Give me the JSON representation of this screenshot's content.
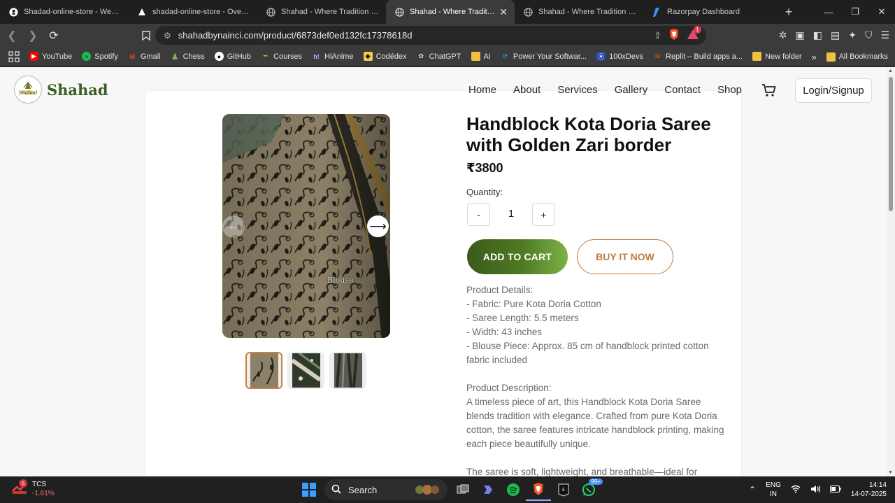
{
  "browser": {
    "tabs": [
      {
        "title": "Shadad-online-store - Web Serv",
        "favicon": "github-icon",
        "active": false
      },
      {
        "title": "shadad-online-store - Overview",
        "favicon": "vercel-icon",
        "active": false
      },
      {
        "title": "Shahad - Where Tradition Meets",
        "favicon": "globe-icon",
        "active": false
      },
      {
        "title": "Shahad - Where Tradition M",
        "favicon": "globe-icon",
        "active": true
      },
      {
        "title": "Shahad - Where Tradition Meets",
        "favicon": "globe-icon",
        "active": false
      },
      {
        "title": "Razorpay Dashboard",
        "favicon": "razorpay-icon",
        "active": false
      }
    ],
    "url": "shahadbynainci.com/product/6873def0ed132fc17378618d",
    "shield_badge": "1",
    "bookmarks": [
      "YouTube",
      "Spotify",
      "Gmail",
      "Chess",
      "GitHub",
      "Courses",
      "HiAnime",
      "Codédex",
      "ChatGPT",
      "AI",
      "Power Your Softwar...",
      "100xDevs",
      "Replit – Build apps a...",
      "New folder"
    ],
    "all_bookmarks": "All Bookmarks"
  },
  "site": {
    "brand": "Shahad",
    "logo_text": "Shahad",
    "nav": [
      "Home",
      "About",
      "Services",
      "Gallery",
      "Contact",
      "Shop"
    ],
    "login_label": "Login/Signup"
  },
  "product": {
    "title": "Handblock Kota Doria Saree with Golden Zari border",
    "price": "₹3800",
    "quantity_label": "Quantity:",
    "quantity": "1",
    "minus": "-",
    "plus": "+",
    "add_to_cart": "ADD TO CART",
    "buy_now": "BUY IT NOW",
    "image_caption": "Blouse",
    "details_heading": "Product Details:",
    "details": [
      "- Fabric: Pure Kota Doria Cotton",
      "- Saree Length: 5.5 meters",
      "- Width: 43 inches",
      "- Blouse Piece: Approx. 85 cm of handblock printed cotton fabric included"
    ],
    "description_heading": "Product Description:",
    "description": "A timeless piece of art, this Handblock Kota Doria Saree blends tradition with elegance. Crafted from pure Kota Doria cotton, the saree features intricate handblock printing, making each piece beautifully unique.",
    "description_more": "The saree is soft, lightweight, and breathable—ideal for"
  },
  "taskbar": {
    "stock_name": "TCS",
    "stock_change": "-1.61%",
    "stock_badge": "6",
    "search_label": "Search",
    "whatsapp_badge": "99+",
    "lang_top": "ENG",
    "lang_bottom": "IN",
    "time": "14:14",
    "date": "14-07-2025"
  },
  "colors": {
    "brand_green": "#3b5e22",
    "accent_orange": "#c27a3c",
    "button_gradient_start": "#3a5a1a",
    "button_gradient_end": "#7bb246"
  }
}
